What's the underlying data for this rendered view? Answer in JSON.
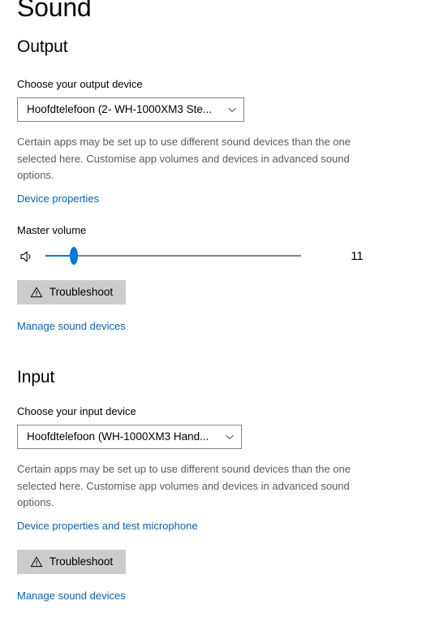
{
  "page": {
    "title": "Sound"
  },
  "output": {
    "heading": "Output",
    "device_label": "Choose your output device",
    "device_value": "Hoofdtelefoon (2- WH-1000XM3 Ste...",
    "description": "Certain apps may be set up to use different sound devices than the one selected here. Customise app volumes and devices in advanced sound options.",
    "device_properties_link": "Device properties",
    "volume_label": "Master volume",
    "volume_value": "11",
    "troubleshoot_label": "Troubleshoot",
    "manage_link": "Manage sound devices"
  },
  "input": {
    "heading": "Input",
    "device_label": "Choose your input device",
    "device_value": "Hoofdtelefoon (WH-1000XM3 Hand...",
    "description": "Certain apps may be set up to use different sound devices than the one selected here. Customise app volumes and devices in advanced sound options.",
    "device_properties_link": "Device properties and test microphone",
    "troubleshoot_label": "Troubleshoot",
    "manage_link": "Manage sound devices"
  },
  "colors": {
    "accent": "#0078d7",
    "link": "#0a62ab",
    "button_face": "#cccccc",
    "border": "#868686",
    "secondary_text": "#5b5b5b"
  },
  "icons": {
    "combo_chevron": "chevron-down-icon",
    "speaker": "speaker-volume-low-icon",
    "troubleshoot": "warning-triangle-icon"
  }
}
